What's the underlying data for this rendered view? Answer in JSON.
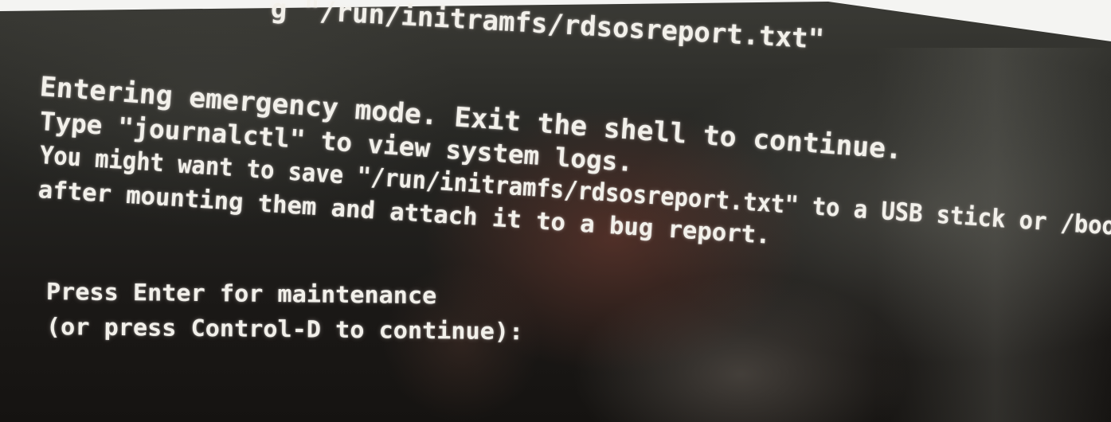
{
  "terminal": {
    "lines": [
      "g \"/run/initramfs/rdsosreport.txt\"",
      "Entering emergency mode. Exit the shell to continue.",
      "Type \"journalctl\" to view system logs.",
      "You might want to save \"/run/initramfs/rdsosreport.txt\" to a USB stick or /boot",
      "after mounting them and attach it to a bug report.",
      "Press Enter for maintenance",
      "(or press Control-D to continue):"
    ]
  },
  "colors": {
    "text": "#f2f0ea",
    "screen_background": "#1b1917"
  }
}
